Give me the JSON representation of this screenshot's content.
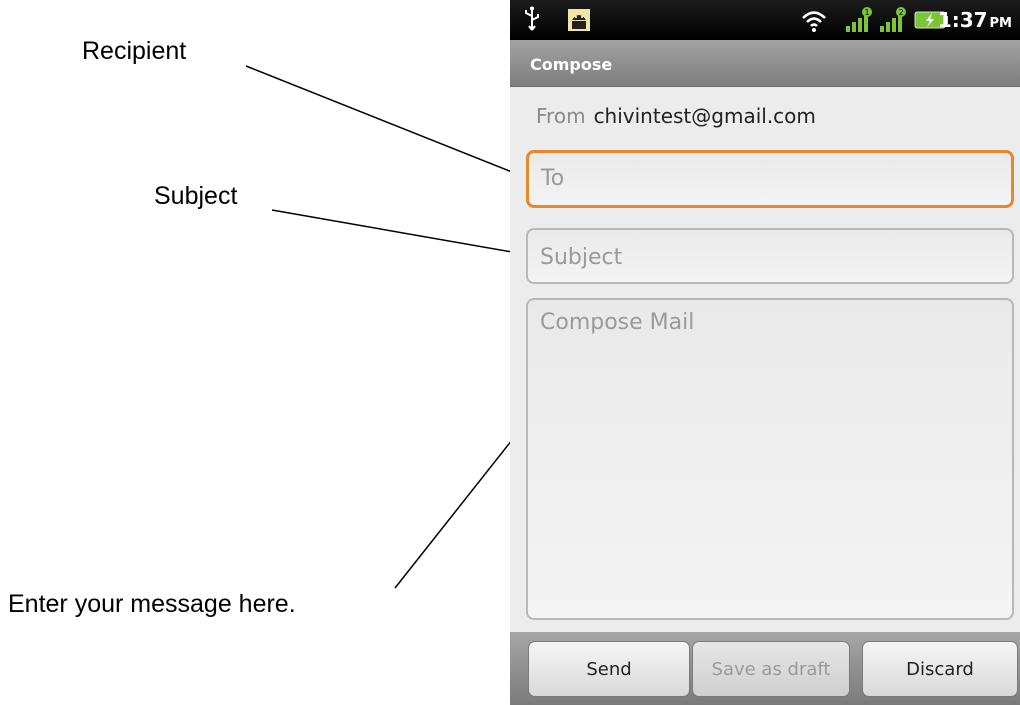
{
  "annotations": {
    "recipient": "Recipient",
    "subject": "Subject",
    "message": "Enter your message here."
  },
  "status_bar": {
    "icons": [
      "usb-icon",
      "android-debug-icon",
      "wifi-icon",
      "signal-1-icon",
      "signal-2-icon",
      "battery-charging-icon"
    ],
    "signal_badges": [
      "1",
      "2"
    ],
    "time": "1:37",
    "ampm": "PM"
  },
  "title": "Compose",
  "from": {
    "label": "From",
    "value": "chivintest@gmail.com"
  },
  "fields": {
    "to_placeholder": "To",
    "subject_placeholder": "Subject",
    "body_placeholder": "Compose Mail"
  },
  "buttons": {
    "send": "Send",
    "save_draft": "Save as draft",
    "discard": "Discard"
  },
  "colors": {
    "focus": "#e7892a",
    "title_bar": "#8f8f8f",
    "status_bar": "#000000"
  }
}
